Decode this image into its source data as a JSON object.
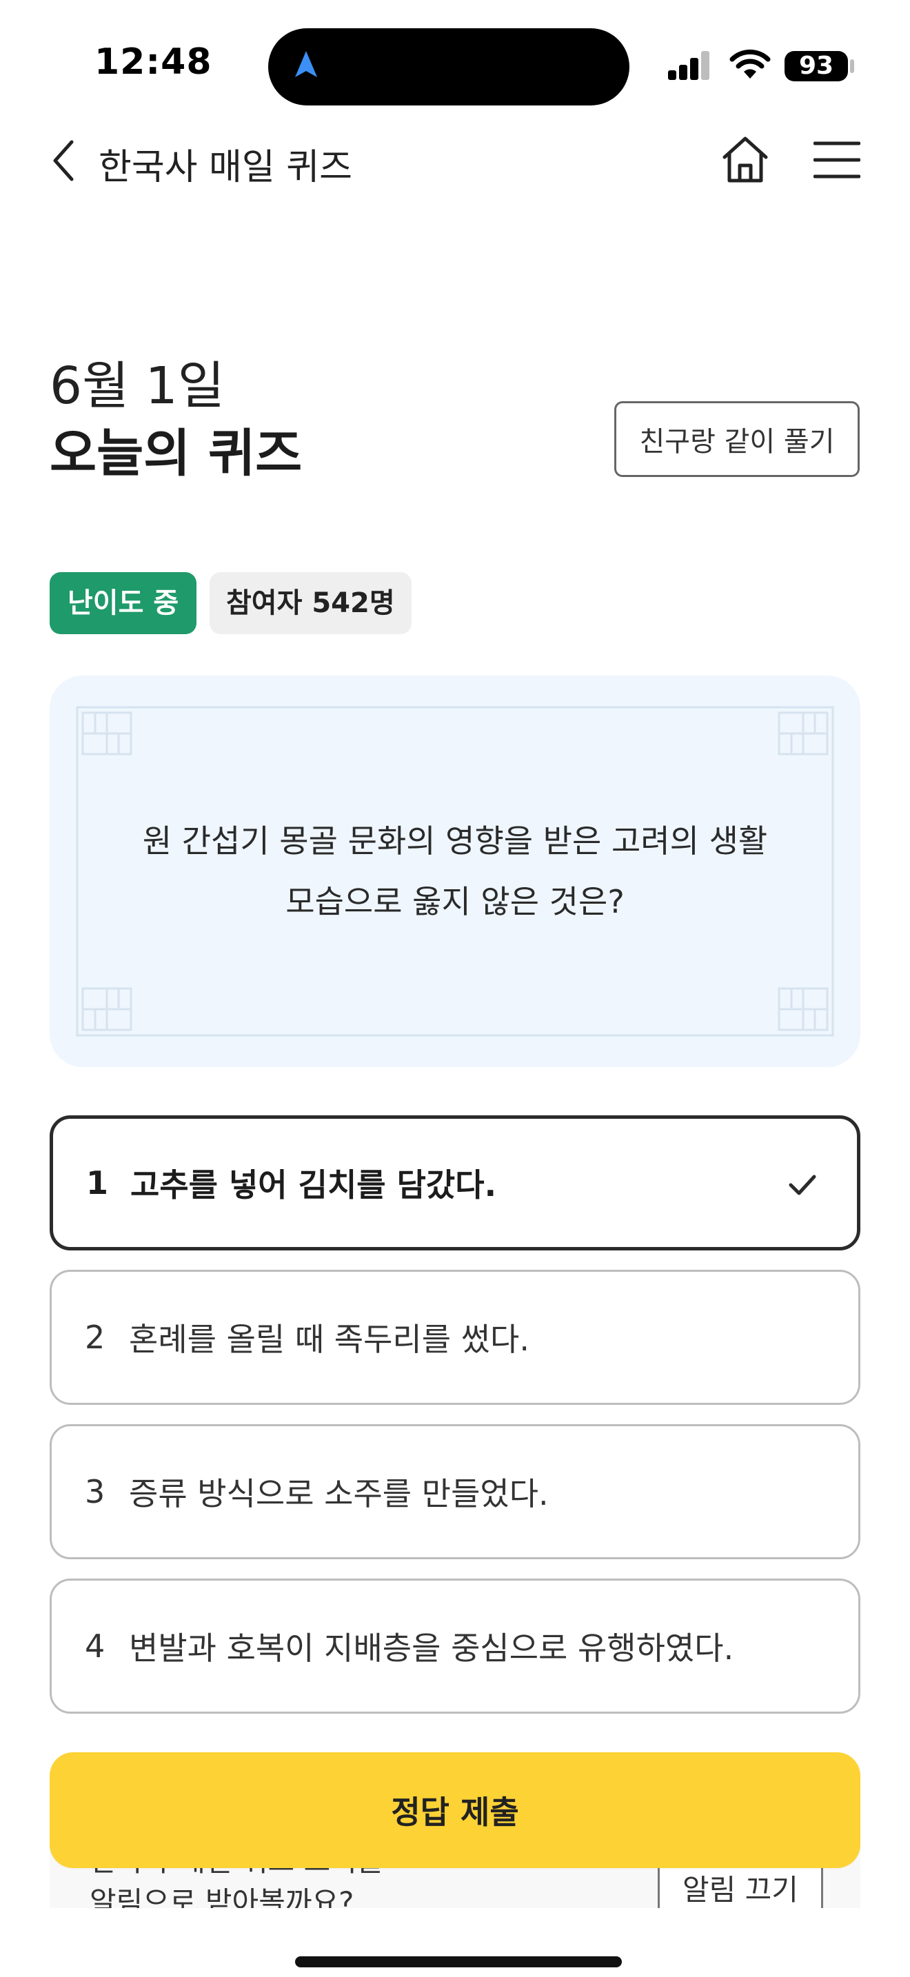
{
  "status_bar": {
    "time": "12:48",
    "battery": "93"
  },
  "nav": {
    "title": "한국사 매일 퀴즈"
  },
  "header": {
    "date": "6월 1일",
    "title": "오늘의 퀴즈",
    "friend_button": "친구랑 같이 풀기"
  },
  "badges": {
    "level": "난이도 중",
    "participants": "참여자 542명"
  },
  "question": {
    "text": "원 간섭기 몽골 문화의 영향을 받은 고려의 생활 모습으로 옳지 않은 것은?"
  },
  "options": [
    {
      "num": "1",
      "text": "고추를 넣어 김치를 담갔다.",
      "selected": true
    },
    {
      "num": "2",
      "text": "혼례를 올릴 때 족두리를 썼다.",
      "selected": false
    },
    {
      "num": "3",
      "text": "증류 방식으로 소주를 만들었다.",
      "selected": false
    },
    {
      "num": "4",
      "text": "변발과 호복이 지배층을 중심으로 유행하였다.",
      "selected": false
    }
  ],
  "notification": {
    "line1": "한국사 매일 퀴즈 소식을",
    "line2": "알림으로 받아볼까요?",
    "button": "알림 끄기"
  },
  "submit_label": "정답 제출",
  "colors": {
    "accent_yellow": "#fdd235",
    "level_green": "#1f9a6a",
    "card_bg": "#eff6fd"
  }
}
